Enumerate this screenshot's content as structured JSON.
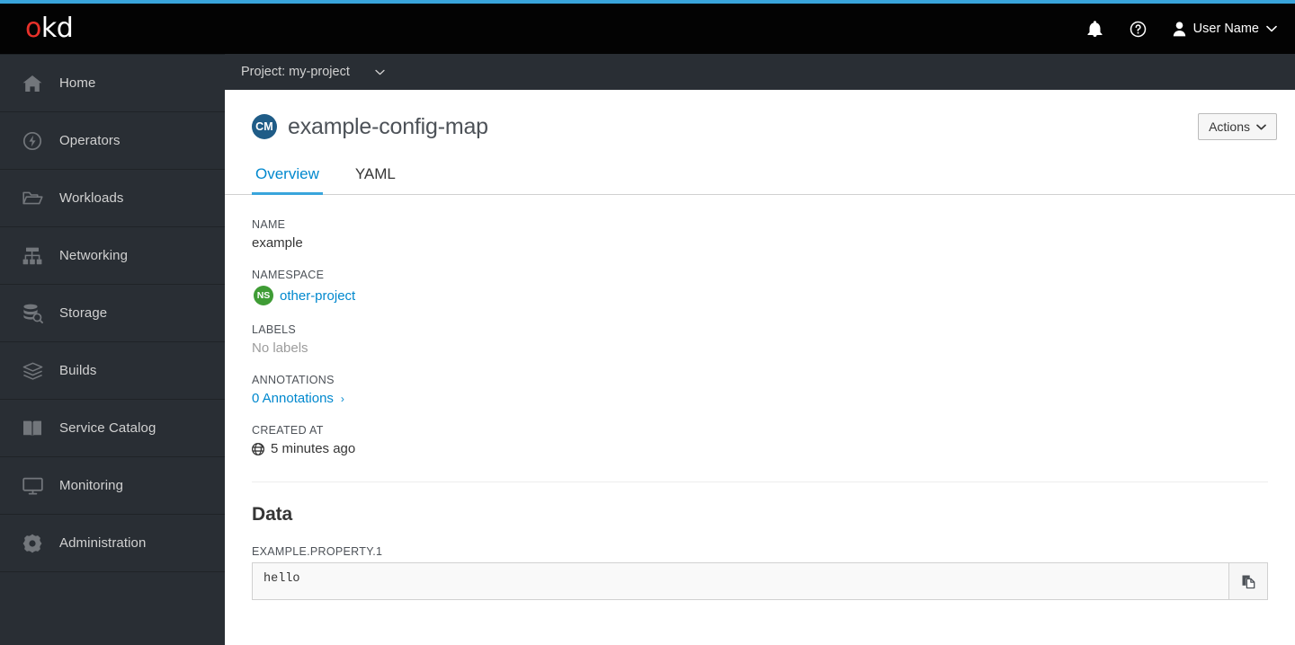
{
  "theme": {
    "accent_blue": "#39a5dc",
    "link_blue": "#0088ce",
    "sidebar_bg": "#292e34",
    "masthead_bg": "#030303",
    "badge_cm_bg": "#1f5c87",
    "badge_ns_bg": "#3f9c35",
    "logo_red": "#e8312a"
  },
  "masthead": {
    "logo": "okd",
    "logo_first_letter": "o",
    "logo_rest": "kd",
    "notifications_icon": "bell-icon",
    "help_icon": "help-circle-icon",
    "user_icon": "user-avatar-icon",
    "user_name": "User Name",
    "user_caret": "⌄"
  },
  "project_bar": {
    "label": "Project: my-project",
    "caret": "⌄"
  },
  "sidebar": {
    "items": [
      {
        "label": "Home",
        "icon": "home-icon"
      },
      {
        "label": "Operators",
        "icon": "operators-icon"
      },
      {
        "label": "Workloads",
        "icon": "folder-icon"
      },
      {
        "label": "Networking",
        "icon": "sitemap-icon"
      },
      {
        "label": "Storage",
        "icon": "database-search-icon"
      },
      {
        "label": "Builds",
        "icon": "layers-icon"
      },
      {
        "label": "Service Catalog",
        "icon": "book-icon"
      },
      {
        "label": "Monitoring",
        "icon": "monitor-icon"
      },
      {
        "label": "Administration",
        "icon": "gear-icon"
      }
    ]
  },
  "page": {
    "resource_badge": "CM",
    "title": "example-config-map",
    "actions_label": "Actions",
    "actions_caret": "⌄",
    "tabs": [
      {
        "label": "Overview",
        "active": true
      },
      {
        "label": "YAML",
        "active": false
      }
    ]
  },
  "details": {
    "name_label": "NAME",
    "name_value": "example",
    "namespace_label": "NAMESPACE",
    "namespace_badge": "NS",
    "namespace_value": "other-project",
    "labels_label": "LABELS",
    "labels_value": "No labels",
    "annotations_label": "ANNOTATIONS",
    "annotations_value": "0 Annotations",
    "annotations_chevron": "›",
    "created_at_label": "CREATED AT",
    "created_at_value": "5 minutes ago"
  },
  "data_section": {
    "heading": "Data",
    "items": [
      {
        "key": "EXAMPLE.PROPERTY.1",
        "value": "hello",
        "copy_icon": "copy-icon"
      }
    ]
  }
}
